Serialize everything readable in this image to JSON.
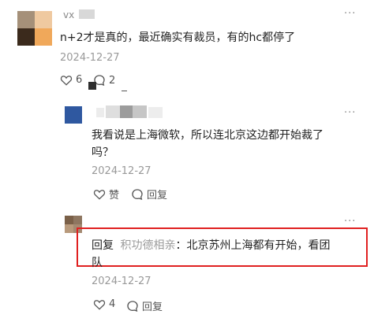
{
  "comment1": {
    "username": "vx",
    "text": "n+2才是真的，最近确实有裁员，有的hc都停了",
    "date": "2024-12-27",
    "likes": "6",
    "replies": "2",
    "more": "···"
  },
  "reply1": {
    "text_line1": "我看说是上海微软，所以连北京这边都开始裁了",
    "text_line2": "吗？",
    "date": "2024-12-27",
    "like_label": "赞",
    "reply_label": "回复",
    "more": "···"
  },
  "reply2": {
    "prefix": "回复",
    "mention": "积功德相亲",
    "text_line1_rest": "：北京苏州上海都有开始，看团",
    "text_line2": "队",
    "date": "2024-12-27",
    "likes": "4",
    "reply_label": "回复",
    "more": "···"
  },
  "colors": {
    "highlight_border": "#e02020",
    "secondary_text": "#999999"
  }
}
